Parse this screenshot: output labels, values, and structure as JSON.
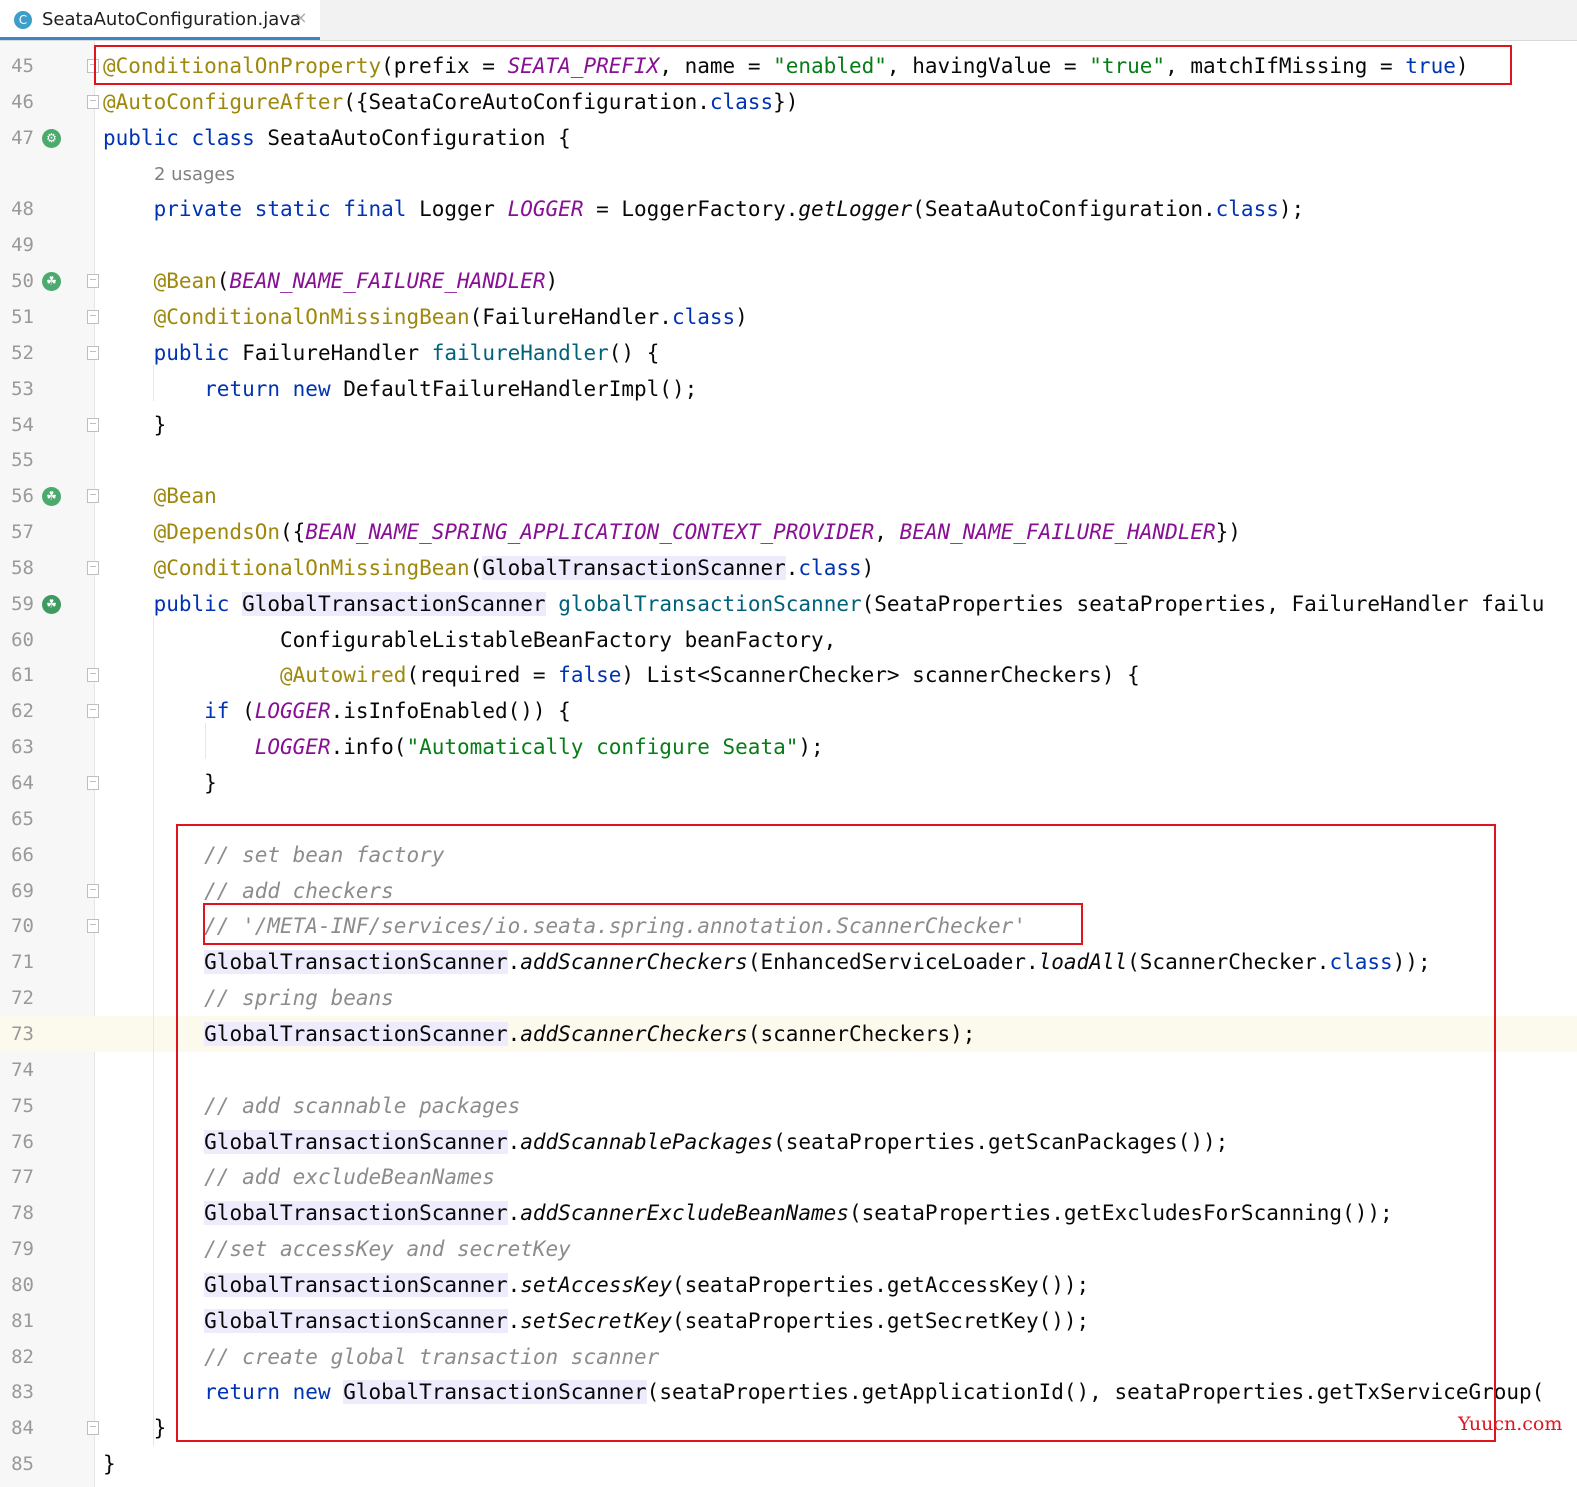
{
  "tab": {
    "icon_letter": "C",
    "file_name": "SeataAutoConfiguration.java",
    "close_glyph": "×"
  },
  "editor": {
    "usages_hint": "2 usages",
    "current_line": "73",
    "lines": [
      {
        "num": "45",
        "gutter_icon": null,
        "fold": true,
        "segments": [
          [
            "ann",
            "@ConditionalOnProperty"
          ],
          [
            "",
            "(prefix = "
          ],
          [
            "const",
            "SEATA_PREFIX"
          ],
          [
            "",
            ", name = "
          ],
          [
            "str",
            "\"enabled\""
          ],
          [
            "",
            ", havingValue = "
          ],
          [
            "str",
            "\"true\""
          ],
          [
            "",
            ", matchIfMissing = "
          ],
          [
            "kw",
            "true"
          ],
          [
            "",
            ")"
          ]
        ]
      },
      {
        "num": "46",
        "gutter_icon": null,
        "fold": true,
        "segments": [
          [
            "ann",
            "@AutoConfigureAfter"
          ],
          [
            "",
            "({SeataCoreAutoConfiguration."
          ],
          [
            "kw",
            "class"
          ],
          [
            "",
            "})"
          ]
        ]
      },
      {
        "num": "47",
        "gutter_icon": "bean-config-icon",
        "fold": false,
        "segments": [
          [
            "kw",
            "public class "
          ],
          [
            "",
            "SeataAutoConfiguration {"
          ]
        ]
      },
      {
        "num": "48",
        "gutter_icon": null,
        "fold": false,
        "segments": [
          [
            "",
            "    "
          ],
          [
            "kw",
            "private static final "
          ],
          [
            "",
            "Logger "
          ],
          [
            "const",
            "LOGGER"
          ],
          [
            "",
            " = LoggerFactory."
          ],
          [
            "stat",
            "getLogger"
          ],
          [
            "",
            "(SeataAutoConfiguration."
          ],
          [
            "kw",
            "class"
          ],
          [
            "",
            ");"
          ]
        ]
      },
      {
        "num": "49",
        "gutter_icon": null,
        "fold": false,
        "segments": []
      },
      {
        "num": "50",
        "gutter_icon": "bean-icon",
        "fold": true,
        "segments": [
          [
            "",
            "    "
          ],
          [
            "ann",
            "@Bean"
          ],
          [
            "",
            "("
          ],
          [
            "const",
            "BEAN_NAME_FAILURE_HANDLER"
          ],
          [
            "",
            ")"
          ]
        ]
      },
      {
        "num": "51",
        "gutter_icon": null,
        "fold": true,
        "segments": [
          [
            "",
            "    "
          ],
          [
            "ann",
            "@ConditionalOnMissingBean"
          ],
          [
            "",
            "(FailureHandler."
          ],
          [
            "kw",
            "class"
          ],
          [
            "",
            ")"
          ]
        ]
      },
      {
        "num": "52",
        "gutter_icon": null,
        "fold": true,
        "segments": [
          [
            "",
            "    "
          ],
          [
            "kw",
            "public "
          ],
          [
            "",
            "FailureHandler "
          ],
          [
            "mdecl",
            "failureHandler"
          ],
          [
            "",
            "() {"
          ]
        ]
      },
      {
        "num": "53",
        "gutter_icon": null,
        "fold": false,
        "segments": [
          [
            "",
            "        "
          ],
          [
            "kw",
            "return new "
          ],
          [
            "",
            "DefaultFailureHandlerImpl();"
          ]
        ]
      },
      {
        "num": "54",
        "gutter_icon": null,
        "fold": true,
        "segments": [
          [
            "",
            "    }"
          ]
        ]
      },
      {
        "num": "55",
        "gutter_icon": null,
        "fold": false,
        "segments": []
      },
      {
        "num": "56",
        "gutter_icon": "bean-icon",
        "fold": true,
        "segments": [
          [
            "",
            "    "
          ],
          [
            "ann",
            "@Bean"
          ]
        ]
      },
      {
        "num": "57",
        "gutter_icon": null,
        "fold": false,
        "segments": [
          [
            "",
            "    "
          ],
          [
            "ann",
            "@DependsOn"
          ],
          [
            "",
            "({"
          ],
          [
            "const",
            "BEAN_NAME_SPRING_APPLICATION_CONTEXT_PROVIDER"
          ],
          [
            "",
            ", "
          ],
          [
            "const",
            "BEAN_NAME_FAILURE_HANDLER"
          ],
          [
            "",
            "})"
          ]
        ]
      },
      {
        "num": "58",
        "gutter_icon": null,
        "fold": true,
        "segments": [
          [
            "",
            "    "
          ],
          [
            "ann",
            "@ConditionalOnMissingBean"
          ],
          [
            "",
            "("
          ],
          [
            "usage",
            "GlobalTransactionScanner"
          ],
          [
            "",
            "."
          ],
          [
            "kw",
            "class"
          ],
          [
            "",
            ")"
          ]
        ]
      },
      {
        "num": "59",
        "gutter_icon": "bean-impl-icon",
        "fold": false,
        "segments": [
          [
            "",
            "    "
          ],
          [
            "kw",
            "public "
          ],
          [
            "usage",
            "GlobalTransactionScanner"
          ],
          [
            "",
            " "
          ],
          [
            "mdecl",
            "globalTransactionScanner"
          ],
          [
            "",
            "(SeataProperties seataProperties, FailureHandler failu"
          ]
        ]
      },
      {
        "num": "60",
        "gutter_icon": null,
        "fold": false,
        "segments": [
          [
            "",
            "              ConfigurableListableBeanFactory beanFactory,"
          ]
        ]
      },
      {
        "num": "61",
        "gutter_icon": null,
        "fold": true,
        "segments": [
          [
            "",
            "              "
          ],
          [
            "ann",
            "@Autowired"
          ],
          [
            "",
            "(required = "
          ],
          [
            "kw",
            "false"
          ],
          [
            "",
            ") List<ScannerChecker> scannerCheckers) {"
          ]
        ]
      },
      {
        "num": "62",
        "gutter_icon": null,
        "fold": true,
        "segments": [
          [
            "",
            "        "
          ],
          [
            "kw",
            "if "
          ],
          [
            "",
            "("
          ],
          [
            "const",
            "LOGGER"
          ],
          [
            "",
            ".isInfoEnabled()) {"
          ]
        ]
      },
      {
        "num": "63",
        "gutter_icon": null,
        "fold": false,
        "segments": [
          [
            "",
            "            "
          ],
          [
            "const",
            "LOGGER"
          ],
          [
            "",
            ".info("
          ],
          [
            "str",
            "\"Automatically configure Seata\""
          ],
          [
            "",
            ");"
          ]
        ]
      },
      {
        "num": "64",
        "gutter_icon": null,
        "fold": true,
        "segments": [
          [
            "",
            "        }"
          ]
        ]
      },
      {
        "num": "65",
        "gutter_icon": null,
        "fold": false,
        "segments": []
      },
      {
        "num": "66",
        "gutter_icon": null,
        "fold": false,
        "segments": [
          [
            "",
            "        "
          ],
          [
            "cmt",
            "// set bean factory"
          ]
        ]
      },
      {
        "num": "69",
        "gutter_icon": null,
        "fold": true,
        "segments": [
          [
            "",
            "        "
          ],
          [
            "cmt",
            "// add checkers"
          ]
        ]
      },
      {
        "num": "70",
        "gutter_icon": null,
        "fold": true,
        "segments": [
          [
            "",
            "        "
          ],
          [
            "cmt",
            "// '/META-INF/services/io.seata.spring.annotation.ScannerChecker'"
          ]
        ]
      },
      {
        "num": "71",
        "gutter_icon": null,
        "fold": false,
        "segments": [
          [
            "",
            "        "
          ],
          [
            "usage",
            "GlobalTransactionScanner"
          ],
          [
            "",
            "."
          ],
          [
            "stat",
            "addScannerCheckers"
          ],
          [
            "",
            "(EnhancedServiceLoader."
          ],
          [
            "stat",
            "loadAll"
          ],
          [
            "",
            "(ScannerChecker."
          ],
          [
            "kw",
            "class"
          ],
          [
            "",
            "));"
          ]
        ]
      },
      {
        "num": "72",
        "gutter_icon": null,
        "fold": false,
        "segments": [
          [
            "",
            "        "
          ],
          [
            "cmt",
            "// spring beans"
          ]
        ]
      },
      {
        "num": "73",
        "gutter_icon": null,
        "fold": false,
        "segments": [
          [
            "",
            "        "
          ],
          [
            "usage",
            "GlobalTransactionScanner"
          ],
          [
            "",
            "."
          ],
          [
            "stat",
            "addScannerCheckers"
          ],
          [
            "",
            "(scannerCheckers);"
          ]
        ]
      },
      {
        "num": "74",
        "gutter_icon": null,
        "fold": false,
        "segments": []
      },
      {
        "num": "75",
        "gutter_icon": null,
        "fold": false,
        "segments": [
          [
            "",
            "        "
          ],
          [
            "cmt",
            "// add scannable packages"
          ]
        ]
      },
      {
        "num": "76",
        "gutter_icon": null,
        "fold": false,
        "segments": [
          [
            "",
            "        "
          ],
          [
            "usage",
            "GlobalTransactionScanner"
          ],
          [
            "",
            "."
          ],
          [
            "stat",
            "addScannablePackages"
          ],
          [
            "",
            "(seataProperties.getScanPackages());"
          ]
        ]
      },
      {
        "num": "77",
        "gutter_icon": null,
        "fold": false,
        "segments": [
          [
            "",
            "        "
          ],
          [
            "cmt",
            "// add excludeBeanNames"
          ]
        ]
      },
      {
        "num": "78",
        "gutter_icon": null,
        "fold": false,
        "segments": [
          [
            "",
            "        "
          ],
          [
            "usage",
            "GlobalTransactionScanner"
          ],
          [
            "",
            "."
          ],
          [
            "stat",
            "addScannerExcludeBeanNames"
          ],
          [
            "",
            "(seataProperties.getExcludesForScanning());"
          ]
        ]
      },
      {
        "num": "79",
        "gutter_icon": null,
        "fold": false,
        "segments": [
          [
            "",
            "        "
          ],
          [
            "cmt",
            "//set accessKey and secretKey"
          ]
        ]
      },
      {
        "num": "80",
        "gutter_icon": null,
        "fold": false,
        "segments": [
          [
            "",
            "        "
          ],
          [
            "usage",
            "GlobalTransactionScanner"
          ],
          [
            "",
            "."
          ],
          [
            "stat",
            "setAccessKey"
          ],
          [
            "",
            "(seataProperties.getAccessKey());"
          ]
        ]
      },
      {
        "num": "81",
        "gutter_icon": null,
        "fold": false,
        "segments": [
          [
            "",
            "        "
          ],
          [
            "usage",
            "GlobalTransactionScanner"
          ],
          [
            "",
            "."
          ],
          [
            "stat",
            "setSecretKey"
          ],
          [
            "",
            "(seataProperties.getSecretKey());"
          ]
        ]
      },
      {
        "num": "82",
        "gutter_icon": null,
        "fold": false,
        "segments": [
          [
            "",
            "        "
          ],
          [
            "cmt",
            "// create global transaction scanner"
          ]
        ]
      },
      {
        "num": "83",
        "gutter_icon": null,
        "fold": false,
        "segments": [
          [
            "",
            "        "
          ],
          [
            "kw",
            "return new "
          ],
          [
            "usage",
            "GlobalTransactionScanner"
          ],
          [
            "",
            "(seataProperties.getApplicationId(), seataProperties.getTxServiceGroup("
          ]
        ]
      },
      {
        "num": "84",
        "gutter_icon": null,
        "fold": true,
        "segments": [
          [
            "",
            "    }"
          ]
        ]
      },
      {
        "num": "85",
        "gutter_icon": null,
        "fold": false,
        "segments": [
          [
            "",
            "}"
          ]
        ]
      }
    ]
  },
  "watermark": "Yuucn.com",
  "colors": {
    "highlight_box": "#e0141e",
    "keyword": "#0033b3",
    "annotation": "#9e880d",
    "string": "#067d17",
    "constant": "#871094",
    "comment": "#8c8c8c"
  }
}
